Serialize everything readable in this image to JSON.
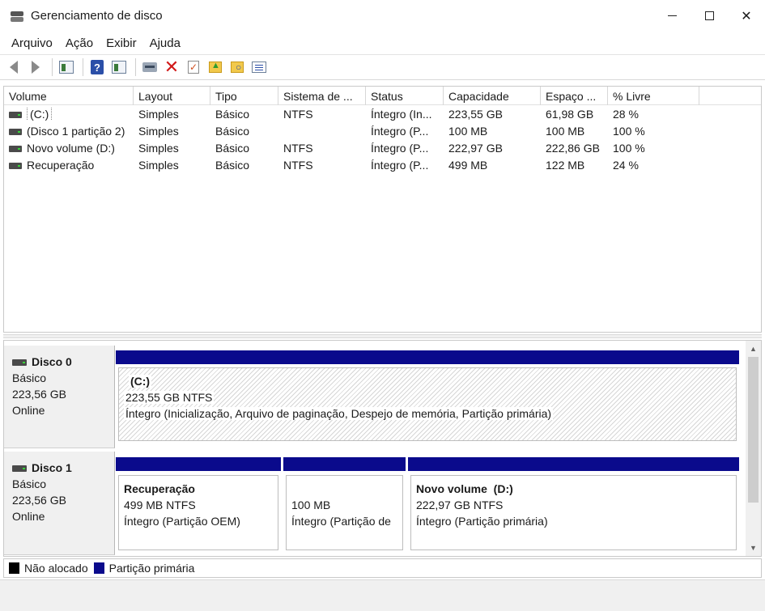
{
  "window": {
    "title": "Gerenciamento de disco"
  },
  "menu": {
    "items": [
      {
        "label": "Arquivo"
      },
      {
        "label": "Ação"
      },
      {
        "label": "Exibir"
      },
      {
        "label": "Ajuda"
      }
    ]
  },
  "toolbar": {
    "icons": [
      "back-icon",
      "forward-icon",
      "console-tree-icon",
      "help-icon",
      "show-pane-icon",
      "connect-drive-icon",
      "delete-icon",
      "check-icon",
      "folder-up-icon",
      "folder-search-icon",
      "properties-list-icon"
    ]
  },
  "volume_list": {
    "columns": [
      "Volume",
      "Layout",
      "Tipo",
      "Sistema de ...",
      "Status",
      "Capacidade",
      "Espaço ...",
      "% Livre"
    ],
    "rows": [
      {
        "volume": "(C:)",
        "layout": "Simples",
        "tipo": "Básico",
        "fs": "NTFS",
        "status": "Íntegro (In...",
        "capacidade": "223,55 GB",
        "espaco": "61,98 GB",
        "livre": "28 %"
      },
      {
        "volume": "(Disco 1 partição 2)",
        "layout": "Simples",
        "tipo": "Básico",
        "fs": "",
        "status": "Íntegro (P...",
        "capacidade": "100 MB",
        "espaco": "100 MB",
        "livre": "100 %"
      },
      {
        "volume": "Novo volume (D:)",
        "layout": "Simples",
        "tipo": "Básico",
        "fs": "NTFS",
        "status": "Íntegro (P...",
        "capacidade": "222,97 GB",
        "espaco": "222,86 GB",
        "livre": "100 %"
      },
      {
        "volume": "Recuperação",
        "layout": "Simples",
        "tipo": "Básico",
        "fs": "NTFS",
        "status": "Íntegro (P...",
        "capacidade": "499 MB",
        "espaco": "122 MB",
        "livre": "24 %"
      }
    ]
  },
  "disks": [
    {
      "name": "Disco 0",
      "type": "Básico",
      "size": "223,56 GB",
      "state": "Online",
      "partitions": [
        {
          "title": "(C:)",
          "size": "223,55 GB NTFS",
          "status": "Íntegro (Inicialização, Arquivo de paginação, Despejo de memória, Partição primária)"
        }
      ]
    },
    {
      "name": "Disco 1",
      "type": "Básico",
      "size": "223,56 GB",
      "state": "Online",
      "partitions": [
        {
          "title": "Recuperação",
          "size": "499 MB NTFS",
          "status": "Íntegro (Partição OEM)"
        },
        {
          "title": "",
          "size": "100 MB",
          "status": "Íntegro (Partição de"
        },
        {
          "title": "Novo volume  (D:)",
          "size": "222,97 GB NTFS",
          "status": "Íntegro (Partição primária)"
        }
      ]
    }
  ],
  "legend": {
    "items": [
      {
        "label": "Não alocado",
        "color": "#000000"
      },
      {
        "label": "Partição primária",
        "color": "#0a0a8c"
      }
    ]
  }
}
